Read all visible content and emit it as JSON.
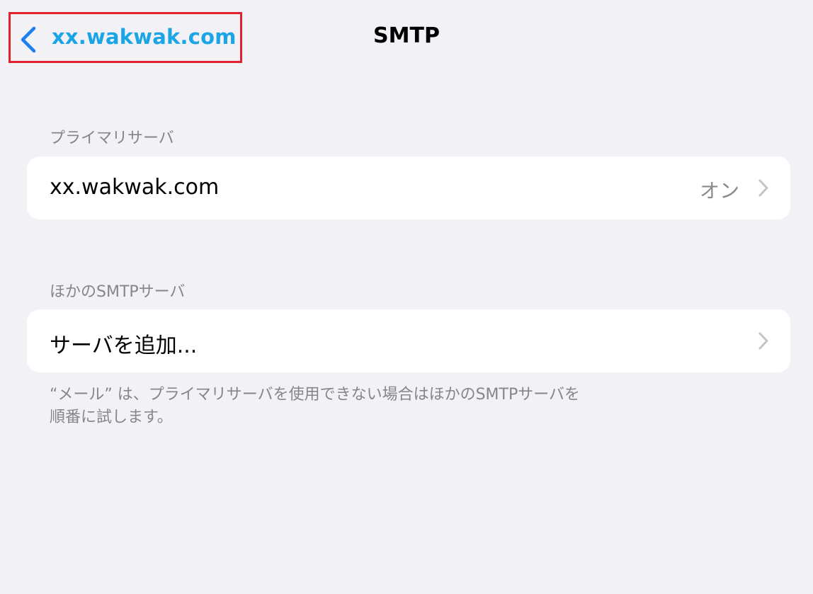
{
  "nav": {
    "back_label": "xx.wakwak.com",
    "title": "SMTP",
    "back_icon": "chevron-left-icon",
    "accent_color": "#1ba5e6",
    "highlight_color": "#e0212e"
  },
  "primary_section": {
    "header": "プライマリサーバ",
    "server_name": "xx.wakwak.com",
    "status": "オン",
    "chevron_icon": "chevron-right-icon"
  },
  "other_section": {
    "header": "ほかのSMTPサーバ",
    "add_label": "サーバを追加...",
    "chevron_icon": "chevron-right-icon"
  },
  "footer": {
    "line1": "“メール” は、プライマリサーバを使用できない場合はほかのSMTPサーバを",
    "line2": "順番に試します。"
  }
}
